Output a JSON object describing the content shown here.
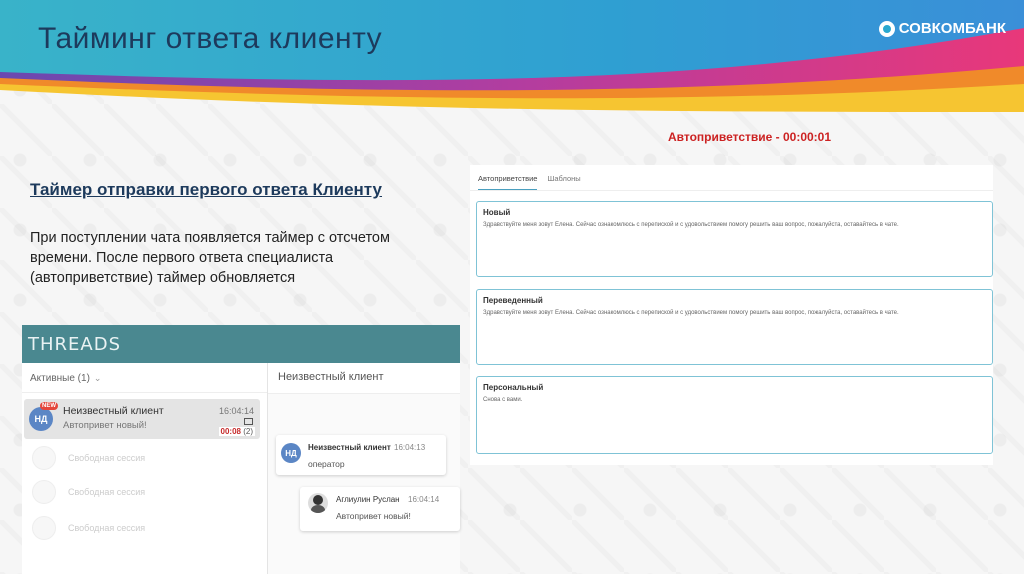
{
  "slide": {
    "title": "Тайминг ответа клиенту",
    "brand": "СОВКОМБАНК"
  },
  "section": {
    "heading": "Таймер отправки первого ответа Клиенту",
    "text": "При поступлении чата появляется таймер с отсчетом времени. После первого ответа специалиста (автоприветствие) таймер обновляется"
  },
  "threads": {
    "app_title": "THREADS",
    "active_tab": "Активные (1)",
    "client_header": "Неизвестный клиент",
    "thread": {
      "avatar": "НД",
      "badge": "NEW",
      "name": "Неизвестный клиент",
      "time": "16:04:14",
      "preview": "Автопривет новый!",
      "timer": "00:08",
      "count": "(2)"
    },
    "free_sessions": [
      "Свободная сессия",
      "Свободная сессия",
      "Свободная сессия"
    ],
    "messages": [
      {
        "avatar": "НД",
        "sender": "Неизвестный клиент",
        "time": "16:04:13",
        "text": "оператор"
      },
      {
        "sender": "Аглиулин Руслан",
        "time": "16:04:14",
        "text": "Автопривет новый!"
      }
    ]
  },
  "templates": {
    "timer_label": "Автоприветствие - 00:00:01",
    "tabs": [
      "Автоприветствие",
      "Шаблоны"
    ],
    "cards": [
      {
        "name": "Новый",
        "text": "Здравствуйте меня зовут Елена. Сейчас ознакомлюсь с перепиской и с удовольствием помогу решить ваш вопрос, пожалуйста, оставайтесь в чате."
      },
      {
        "name": "Переведенный",
        "text": "Здравствуйте меня зовут Елена. Сейчас ознакомлюсь с перепиской и с удовольствием помогу решить ваш вопрос, пожалуйста, оставайтесь в чате."
      },
      {
        "name": "Персональный",
        "text": "Снова с вами."
      }
    ]
  },
  "colors": {
    "title": "#1d3a5c",
    "threads_bar": "#4a8890",
    "timer_red": "#cc2222",
    "card_border": "#7fc3d6"
  }
}
